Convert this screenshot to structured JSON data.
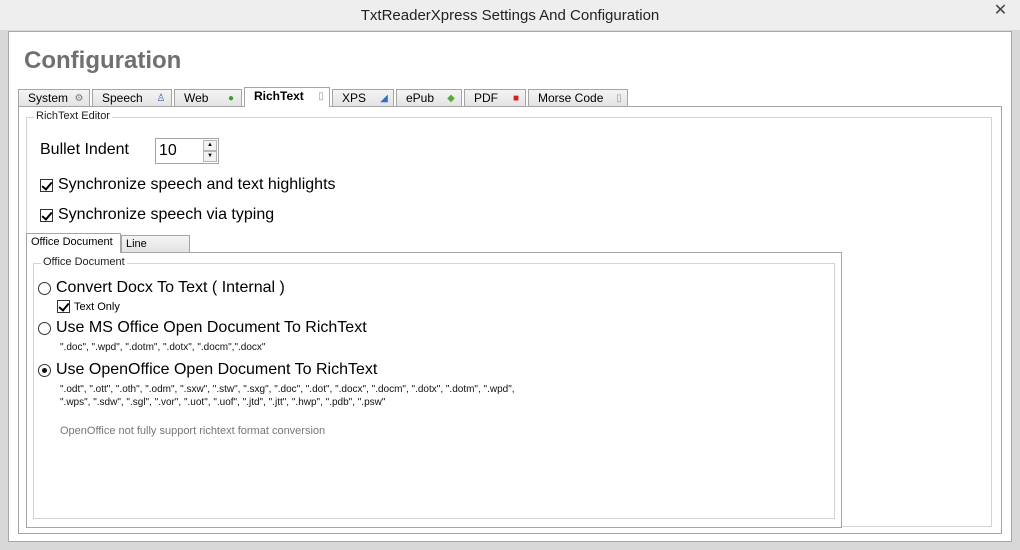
{
  "window": {
    "title": "TxtReaderXpress Settings And Configuration",
    "close_label": "✕"
  },
  "heading": "Configuration",
  "tabs": [
    {
      "label": "System",
      "icon": "gear-icon",
      "icon_glyph": "⚙"
    },
    {
      "label": "Speech",
      "icon": "person-icon",
      "icon_glyph": "♙"
    },
    {
      "label": "Web",
      "icon": "globe-icon",
      "icon_glyph": "●"
    },
    {
      "label": "RichText",
      "icon": "document-icon",
      "icon_glyph": "▯"
    },
    {
      "label": "XPS",
      "icon": "xps-icon",
      "icon_glyph": "◢"
    },
    {
      "label": "ePub",
      "icon": "epub-icon",
      "icon_glyph": "◆"
    },
    {
      "label": "PDF",
      "icon": "pdf-icon",
      "icon_glyph": "■"
    },
    {
      "label": "Morse Code",
      "icon": "document-icon",
      "icon_glyph": "▯"
    }
  ],
  "richtext_group": {
    "label": "RichText Editor",
    "bullet_indent_label": "Bullet Indent",
    "bullet_indent_value": "10",
    "sync_highlights_label": "Synchronize speech and text highlights",
    "sync_typing_label": "Synchronize speech via typing"
  },
  "subtabs": [
    {
      "label": "Office Document"
    },
    {
      "label": "Line Number"
    }
  ],
  "office_group": {
    "label": "Office Document",
    "option1_label": "Convert Docx To Text ( Internal )",
    "text_only_label": "Text Only",
    "option2_label": "Use MS Office Open Document To RichText",
    "option2_exts": "\".doc\", \".wpd\", \".dotm\", \".dotx\", \".docm\",\".docx\"",
    "option3_label": "Use OpenOffice Open Document To RichText",
    "option3_exts_line1": "\".odt\", \".ott\", \".oth\", \".odm\", \".sxw\", \".stw\", \".sxg\", \".doc\", \".dot\", \".docx\", \".docm\", \".dotx\", \".dotm\", \".wpd\",",
    "option3_exts_line2": "\".wps\", \".sdw\", \".sgl\", \".vor\", \".uot\", \".uof\", \".jtd\", \".jtt\", \".hwp\", \".pdb\", \".psw\"",
    "note": "OpenOffice not fully support richtext format conversion"
  },
  "icon_colors": {
    "gear-icon": "#777777",
    "person-icon": "#3a5ea8",
    "globe-icon": "#3c9b2e",
    "document-icon": "#9a9a9a",
    "xps-icon": "#2f6fc4",
    "epub-icon": "#5ba83a",
    "pdf-icon": "#d22020"
  }
}
